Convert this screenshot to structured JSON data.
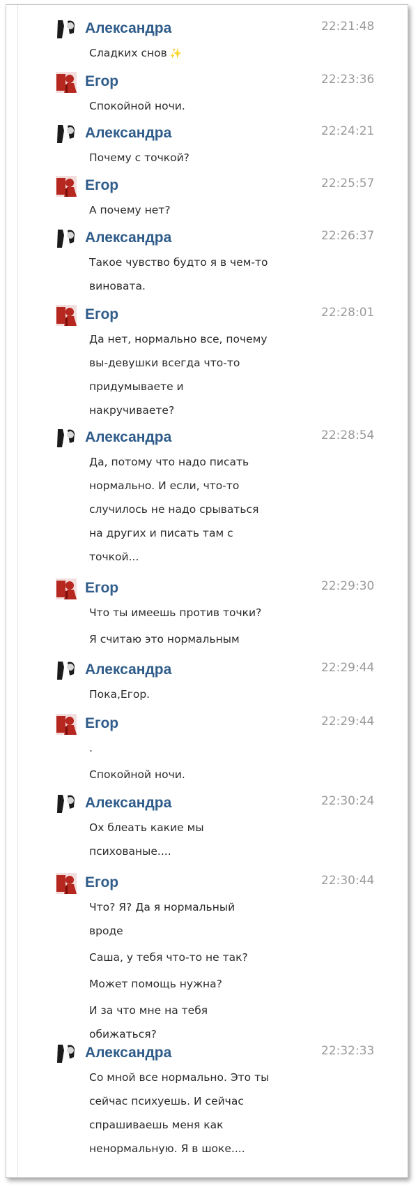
{
  "colors": {
    "author": "#2f5c8a",
    "time": "#9a9a9a",
    "text": "#2b2b2b",
    "avatar_egor": "#b5271f",
    "avatar_aleksandra": "#1b1b1b"
  },
  "messages": [
    {
      "author": "Александра",
      "avatar": "avatar-aleksandra-icon",
      "time": "22:21:48",
      "lines": [
        "Сладких снов"
      ],
      "sparkle": "✨"
    },
    {
      "author": "Егор",
      "avatar": "avatar-egor-icon",
      "time": "22:23:36",
      "lines": [
        "Спокойной ночи."
      ]
    },
    {
      "author": "Александра",
      "avatar": "avatar-aleksandra-icon",
      "time": "22:24:21",
      "lines": [
        "Почему с точкой?"
      ]
    },
    {
      "author": "Егор",
      "avatar": "avatar-egor-icon",
      "time": "22:25:57",
      "lines": [
        "А почему нет?"
      ]
    },
    {
      "author": "Александра",
      "avatar": "avatar-aleksandra-icon",
      "time": "22:26:37",
      "lines": [
        "Такое чувство будто я в чем-то",
        "виновата."
      ]
    },
    {
      "author": "Егор",
      "avatar": "avatar-egor-icon",
      "time": "22:28:01",
      "lines": [
        "Да нет, нормально все, почему",
        "вы-девушки всегда что-то",
        "придумываете и",
        "накручиваете?"
      ]
    },
    {
      "author": "Александра",
      "avatar": "avatar-aleksandra-icon",
      "time": "22:28:54",
      "lines": [
        "Да, потому что надо писать",
        "нормально. И если, что-то",
        "случилось не надо срываться",
        "на других и писать там с",
        "точкой..."
      ]
    },
    {
      "author": "Егор",
      "avatar": "avatar-egor-icon",
      "time": "22:29:30",
      "lines": [
        "Что ты имеешь против точки?",
        "Я считаю это нормальным"
      ]
    },
    {
      "author": "Александра",
      "avatar": "avatar-aleksandra-icon",
      "time": "22:29:44",
      "lines": [
        "Пока,Егор."
      ]
    },
    {
      "author": "Егор",
      "avatar": "avatar-egor-icon",
      "time": "22:29:44",
      "lines": [
        ".",
        "Спокойной ночи."
      ]
    },
    {
      "author": "Александра",
      "avatar": "avatar-aleksandra-icon",
      "time": "22:30:24",
      "lines": [
        "Ох блеать какие мы",
        "психованые...."
      ]
    },
    {
      "author": "Егор",
      "avatar": "avatar-egor-icon",
      "time": "22:30:44",
      "lines": [
        "Что? Я? Да я нормальный",
        "вроде",
        "Саша, у тебя что-то не так?",
        "Может помощь нужна?",
        "И за что мне на тебя",
        "обижаться?"
      ]
    },
    {
      "author": "Александра",
      "avatar": "avatar-aleksandra-icon",
      "time": "22:32:33",
      "lines": [
        "Со мной все нормально. Это ты",
        "сейчас психуешь. И сейчас",
        "спрашиваешь меня как",
        "ненормальную. Я в шоке...."
      ]
    }
  ]
}
